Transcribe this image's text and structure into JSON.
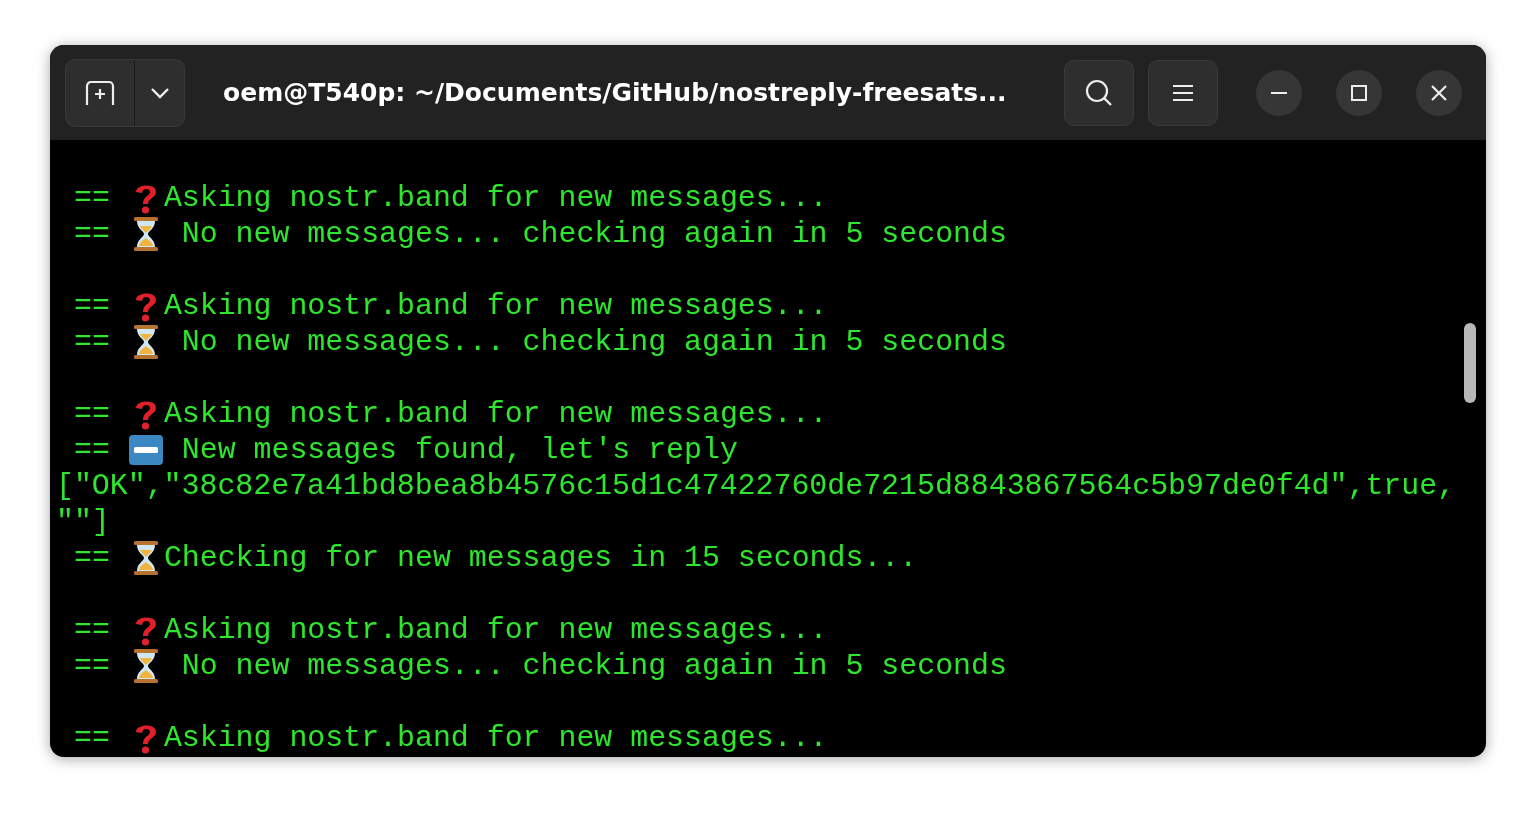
{
  "window": {
    "title": "oem@T540p: ~/Documents/GitHub/nostreply-freesats..."
  },
  "terminal": {
    "lines": [
      {
        "kind": "blank"
      },
      {
        "kind": "ask",
        "prefix": "==",
        "text": "Asking nostr.band for new messages..."
      },
      {
        "kind": "wait",
        "prefix": "==",
        "text": " No new messages... checking again in 5 seconds"
      },
      {
        "kind": "blank"
      },
      {
        "kind": "ask",
        "prefix": "==",
        "text": "Asking nostr.band for new messages..."
      },
      {
        "kind": "wait",
        "prefix": "==",
        "text": " No new messages... checking again in 5 seconds"
      },
      {
        "kind": "blank"
      },
      {
        "kind": "ask",
        "prefix": "==",
        "text": "Asking nostr.band for new messages..."
      },
      {
        "kind": "new",
        "prefix": "==",
        "text": " New messages found, let's reply"
      },
      {
        "kind": "raw",
        "text": "[\"OK\",\"38c82e7a41bd8bea8b4576c15d1c47422760de7215d8843867564c5b97de0f4d\",true,"
      },
      {
        "kind": "raw",
        "text": "\"\"]"
      },
      {
        "kind": "wait",
        "prefix": "==",
        "text": "Checking for new messages in 15 seconds..."
      },
      {
        "kind": "blank"
      },
      {
        "kind": "ask",
        "prefix": "==",
        "text": "Asking nostr.band for new messages..."
      },
      {
        "kind": "wait",
        "prefix": "==",
        "text": " No new messages... checking again in 5 seconds"
      },
      {
        "kind": "blank"
      },
      {
        "kind": "ask",
        "prefix": "==",
        "text": "Asking nostr.band for new messages..."
      }
    ]
  }
}
